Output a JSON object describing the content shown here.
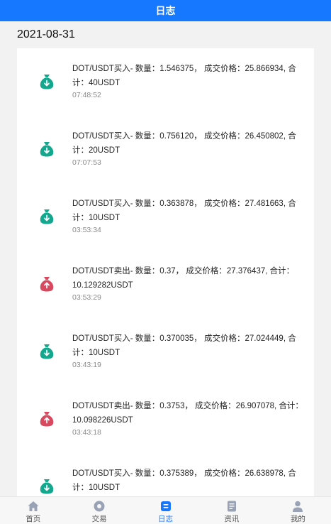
{
  "header": {
    "title": "日志"
  },
  "date": "2021-08-31",
  "colors": {
    "accent": "#1677ff",
    "buy": "#13a88e",
    "sell": "#d8485f"
  },
  "logs": [
    {
      "type": "buy",
      "icon": "money-bag-down-icon",
      "text": "DOT/USDT买入- 数量：1.546375，  成交价格：25.866934, 合计：40USDT",
      "time": "07:48:52"
    },
    {
      "type": "buy",
      "icon": "money-bag-down-icon",
      "text": "DOT/USDT买入- 数量：0.756120，  成交价格：26.450802, 合计：20USDT",
      "time": "07:07:53"
    },
    {
      "type": "buy",
      "icon": "money-bag-down-icon",
      "text": "DOT/USDT买入- 数量：0.363878，  成交价格：27.481663, 合计：10USDT",
      "time": "03:53:34"
    },
    {
      "type": "sell",
      "icon": "money-bag-up-icon",
      "text": "DOT/USDT卖出- 数量：0.37，  成交价格：27.376437, 合计：10.129282USDT",
      "time": "03:53:29"
    },
    {
      "type": "buy",
      "icon": "money-bag-down-icon",
      "text": "DOT/USDT买入- 数量：0.370035，  成交价格：27.024449, 合计：10USDT",
      "time": "03:43:19"
    },
    {
      "type": "sell",
      "icon": "money-bag-up-icon",
      "text": "DOT/USDT卖出- 数量：0.3753，  成交价格：26.907078, 合计：10.098226USDT",
      "time": "03:43:18"
    },
    {
      "type": "buy",
      "icon": "money-bag-down-icon",
      "text": "DOT/USDT买入- 数量：0.375389，  成交价格：26.638978, 合计：10USDT",
      "time": ""
    }
  ],
  "tabs": [
    {
      "label": "首页",
      "icon": "home-icon",
      "active": false
    },
    {
      "label": "交易",
      "icon": "trade-icon",
      "active": false
    },
    {
      "label": "日志",
      "icon": "log-icon",
      "active": true
    },
    {
      "label": "资讯",
      "icon": "news-icon",
      "active": false
    },
    {
      "label": "我的",
      "icon": "user-icon",
      "active": false
    }
  ]
}
